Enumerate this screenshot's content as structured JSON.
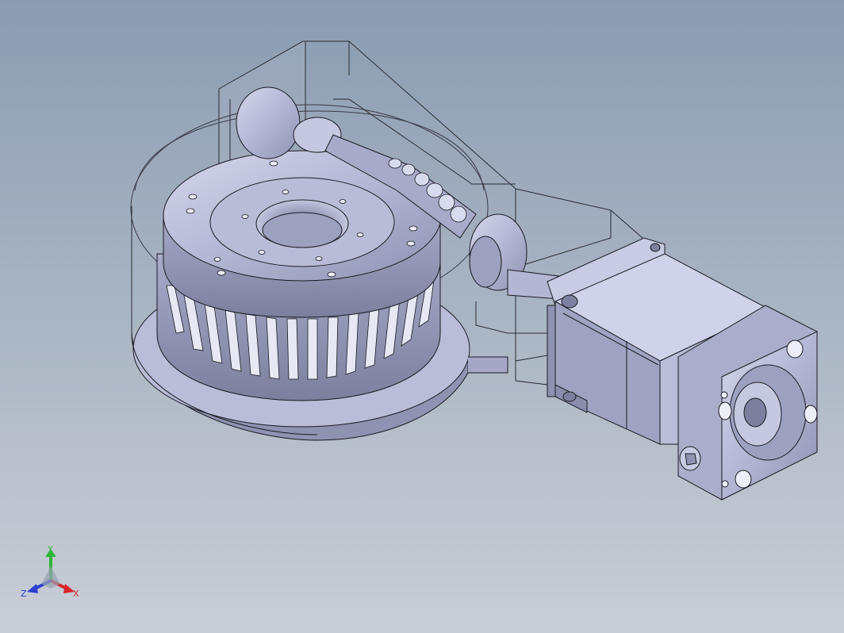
{
  "viewport": {
    "background_top": "#8b9cb1",
    "background_bottom": "#c9ced6"
  },
  "triad": {
    "x_label": "X",
    "y_label": "Y",
    "z_label": "Z",
    "x_color": "#d8262b",
    "y_color": "#2fb53a",
    "z_color": "#2c3fcf"
  },
  "model": {
    "part_fill": "#b9bdd8",
    "part_shade": "#8f93b2",
    "edge_color": "#1b1b22",
    "housing_line": "#2a2a30"
  }
}
